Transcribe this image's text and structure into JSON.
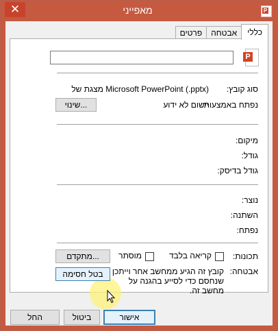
{
  "window": {
    "title": "מאפייני",
    "close_glyph": "✕",
    "app_icon_letter": "P"
  },
  "tabs": [
    {
      "label": "כללי"
    },
    {
      "label": "אבטחה"
    },
    {
      "label": "פרטים"
    }
  ],
  "general": {
    "file_name_value": "",
    "file_icon_letter": "P",
    "file_type_label": "סוג קובץ:",
    "file_type_value": "מצגת של Microsoft PowerPoint (.pptx)",
    "opens_with_label": "נפתח באמצעות:",
    "opens_with_value": "יישום לא ידוע",
    "change_button": "שינוי...",
    "location_label": "מיקום:",
    "size_label": "גודל:",
    "size_on_disk_label": "גודל בדיסק:",
    "created_label": "נוצר:",
    "modified_label": "השתנה:",
    "accessed_label": "נפתח:",
    "attributes_label": "תכונות:",
    "readonly_label": "קריאה בלבד",
    "hidden_label": "מוסתר",
    "advanced_button": "מתקדם...",
    "security_label": "אבטחה:",
    "security_text_1": "קובץ זה הגיע ממחשב אחר וייתכן",
    "security_text_2": "שנחסם כדי לסייע בהגנה על",
    "security_text_3": "מחשב זה.",
    "unblock_button": "בטל חסימה"
  },
  "footer": {
    "ok": "אישור",
    "cancel": "ביטול",
    "apply": "החל"
  },
  "colors": {
    "titlebar": "#c55a41",
    "close": "#c7432b",
    "accent": "#3c7fb1"
  }
}
